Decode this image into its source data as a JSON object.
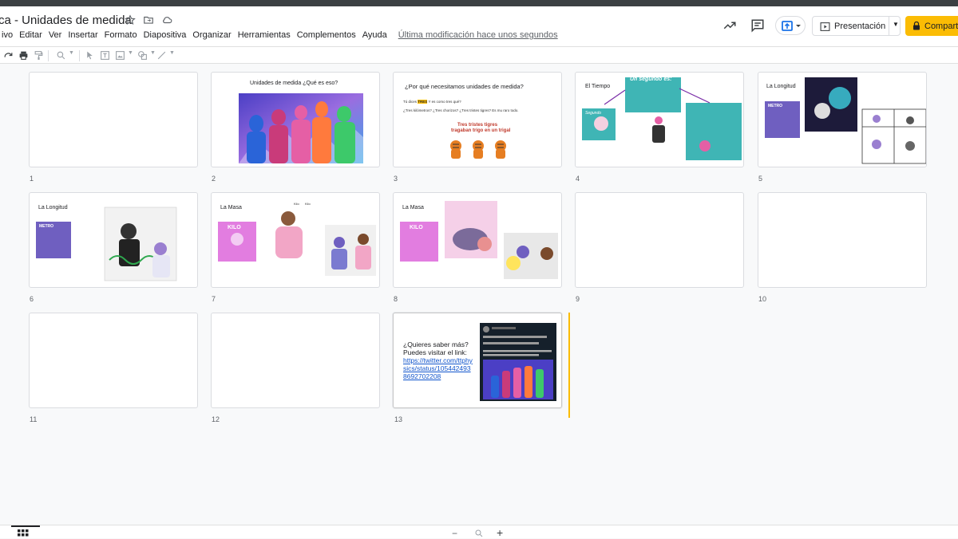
{
  "app": {
    "title": "ca - Unidades de medida",
    "last_modified": "Última modificación hace unos segundos"
  },
  "menu": [
    "ivo",
    "Editar",
    "Ver",
    "Insertar",
    "Formato",
    "Diapositiva",
    "Organizar",
    "Herramientas",
    "Complementos",
    "Ayuda"
  ],
  "buttons": {
    "present": "Presentación",
    "share": "Compart"
  },
  "slide_numbers": [
    "1",
    "2",
    "3",
    "4",
    "5",
    "6",
    "7",
    "8",
    "9",
    "10",
    "11",
    "12",
    "13"
  ],
  "slides": {
    "s2": {
      "title": "Unidades de medida ¿Qué es eso?"
    },
    "s3": {
      "title": "¿Por qué necesitamos unidades de medida?",
      "line1_a": "Tú dices ",
      "line1_hl": "TRES",
      "line1_b": " Y es como tres qué?",
      "line2": "¿Tres kilómetros? ¿Tres chorizos? ¿Tres tristes tigres? Es mu raro todo.",
      "tongue1": "Tres tristes tigres",
      "tongue2": "tragaban trigo en un trigal"
    },
    "s4": {
      "title": "El Tiempo",
      "banner": "Un segundo es:",
      "sign": "Segundo"
    },
    "s5": {
      "title": "La Longitud",
      "logo": "METRO"
    },
    "s6": {
      "title": "La Longitud",
      "logo": "METRO"
    },
    "s7": {
      "title": "La Masa",
      "kilo": "KILO",
      "l1": "Kilo",
      "l2": "Kilo"
    },
    "s8": {
      "title": "La Masa",
      "kilo": "KILO"
    },
    "s13": {
      "q1": "¿Quieres saber más?",
      "q2": "Puedes visitar el link:",
      "link": "https://twitter.com/ttphysics/status/1054424938692702208"
    }
  },
  "colors": {
    "share": "#fbbc04",
    "accent_cursor": "#fbbc04",
    "link": "#1155cc",
    "teal": "#3fb5b5"
  }
}
